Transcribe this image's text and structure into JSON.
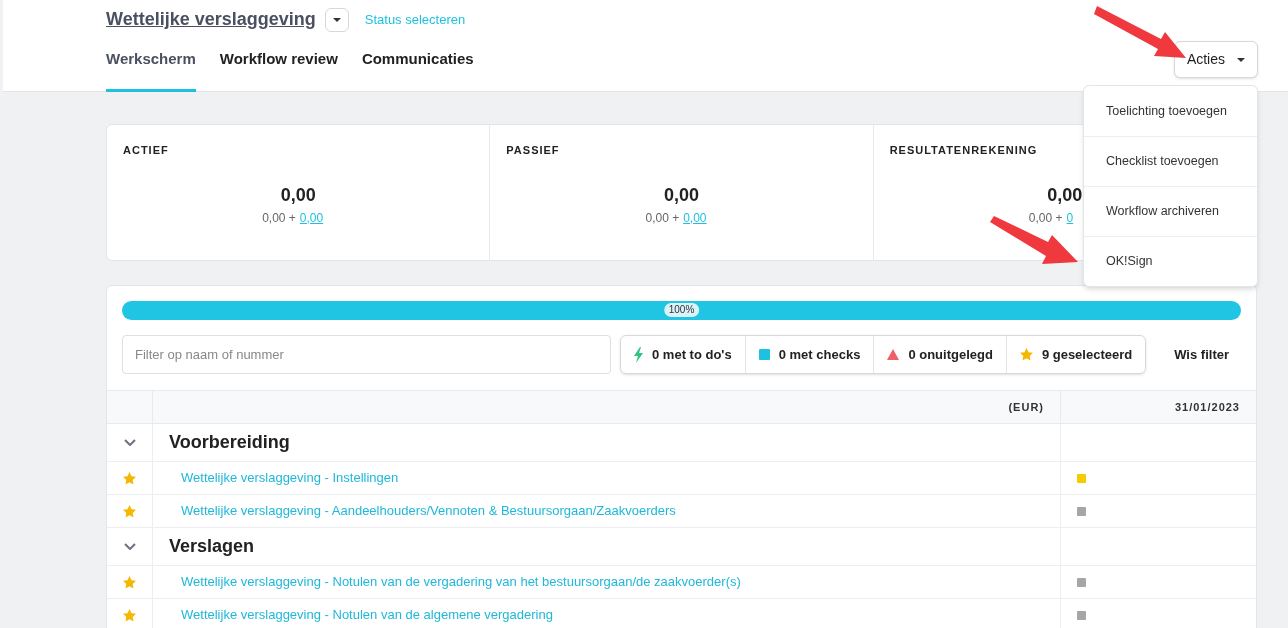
{
  "header": {
    "title": "Wettelijke verslaggeving",
    "status_link": "Status selecteren",
    "tabs": [
      {
        "label": "Werkscherm",
        "selected": true
      },
      {
        "label": "Workflow review",
        "selected": false
      },
      {
        "label": "Communicaties",
        "selected": false
      }
    ],
    "actions_button": "Acties"
  },
  "actions_menu": [
    "Toelichting toevoegen",
    "Checklist toevoegen",
    "Workflow archiveren",
    "OK!Sign"
  ],
  "summary_cards": [
    {
      "title": "ACTIEF",
      "total": "0,00",
      "base": "0,00 +",
      "link": "0,00"
    },
    {
      "title": "PASSIEF",
      "total": "0,00",
      "base": "0,00 +",
      "link": "0,00"
    },
    {
      "title": "RESULTATENREKENING",
      "total": "0,00",
      "base": "0,00 +",
      "link": "0"
    }
  ],
  "progress": {
    "level": 1,
    "label": "100%"
  },
  "filter": {
    "placeholder": "Filter op naam of nummer"
  },
  "filter_chips": [
    {
      "kind": "bolt",
      "label": "0 met to do's"
    },
    {
      "kind": "square",
      "label": "0 met checks"
    },
    {
      "kind": "triangle",
      "label": "0 onuitgelegd"
    },
    {
      "kind": "star",
      "label": "9 geselecteerd"
    }
  ],
  "clear_filter": "Wis filter",
  "table": {
    "columns": [
      "(EUR)",
      "31/01/2023"
    ],
    "groups": [
      {
        "title": "Voorbereiding",
        "expanded": true,
        "rows": [
          {
            "label": "Wettelijke verslaggeving - Instellingen",
            "starred": true,
            "color": "#f5cc00"
          },
          {
            "label": "Wettelijke verslaggeving - Aandeelhouders/Vennoten & Bestuursorgaan/Zaakvoerders",
            "starred": true,
            "color": "#a6a6a6"
          }
        ]
      },
      {
        "title": "Verslagen",
        "expanded": true,
        "rows": [
          {
            "label": "Wettelijke verslaggeving - Notulen van de vergadering van het bestuursorgaan/de zaakvoerder(s)",
            "starred": true,
            "color": "#a6a6a6"
          },
          {
            "label": "Wettelijke verslaggeving - Notulen van de algemene vergadering",
            "starred": true,
            "color": "#a6a6a6"
          }
        ]
      }
    ]
  }
}
